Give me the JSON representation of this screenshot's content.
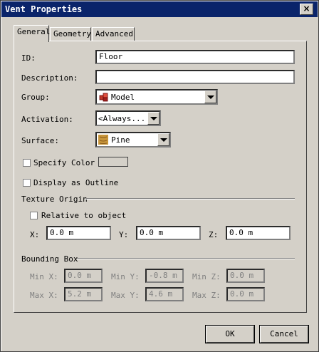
{
  "window": {
    "title": "Vent Properties",
    "close_symbol": "×"
  },
  "tabs": [
    {
      "label": "General"
    },
    {
      "label": "Geometry"
    },
    {
      "label": "Advanced"
    }
  ],
  "general": {
    "id_label": "ID:",
    "id_value": "Floor",
    "description_label": "Description:",
    "description_value": "",
    "group_label": "Group:",
    "group_value": "Model",
    "activation_label": "Activation:",
    "activation_value": "<Always...",
    "surface_label": "Surface:",
    "surface_value": "Pine",
    "specify_color_label": "Specify Color",
    "display_outline_label": "Display as Outline",
    "texture_origin_label": "Texture Origin",
    "relative_label": "Relative to object",
    "tex_x_label": "X:",
    "tex_x_value": "0.0 m",
    "tex_y_label": "Y:",
    "tex_y_value": "0.0 m",
    "tex_z_label": "Z:",
    "tex_z_value": "0.0 m",
    "bbox_label": "Bounding Box",
    "min_x_label": "Min X:",
    "min_x_value": "0.0 m",
    "min_y_label": "Min Y:",
    "min_y_value": "-0.8 m",
    "min_z_label": "Min Z:",
    "min_z_value": "0.0 m",
    "max_x_label": "Max X:",
    "max_x_value": "5.2 m",
    "max_y_label": "Max Y:",
    "max_y_value": "4.6 m",
    "max_z_label": "Max Z:",
    "max_z_value": "0.0 m"
  },
  "buttons": {
    "ok": "OK",
    "cancel": "Cancel"
  },
  "icons": {
    "group": "model-group-icon",
    "surface": "pine-texture-icon"
  },
  "colors": {
    "title_bar": "#0a246a",
    "face": "#d4d0c8",
    "pine": "#c8963c",
    "model_red": "#c0392b"
  }
}
